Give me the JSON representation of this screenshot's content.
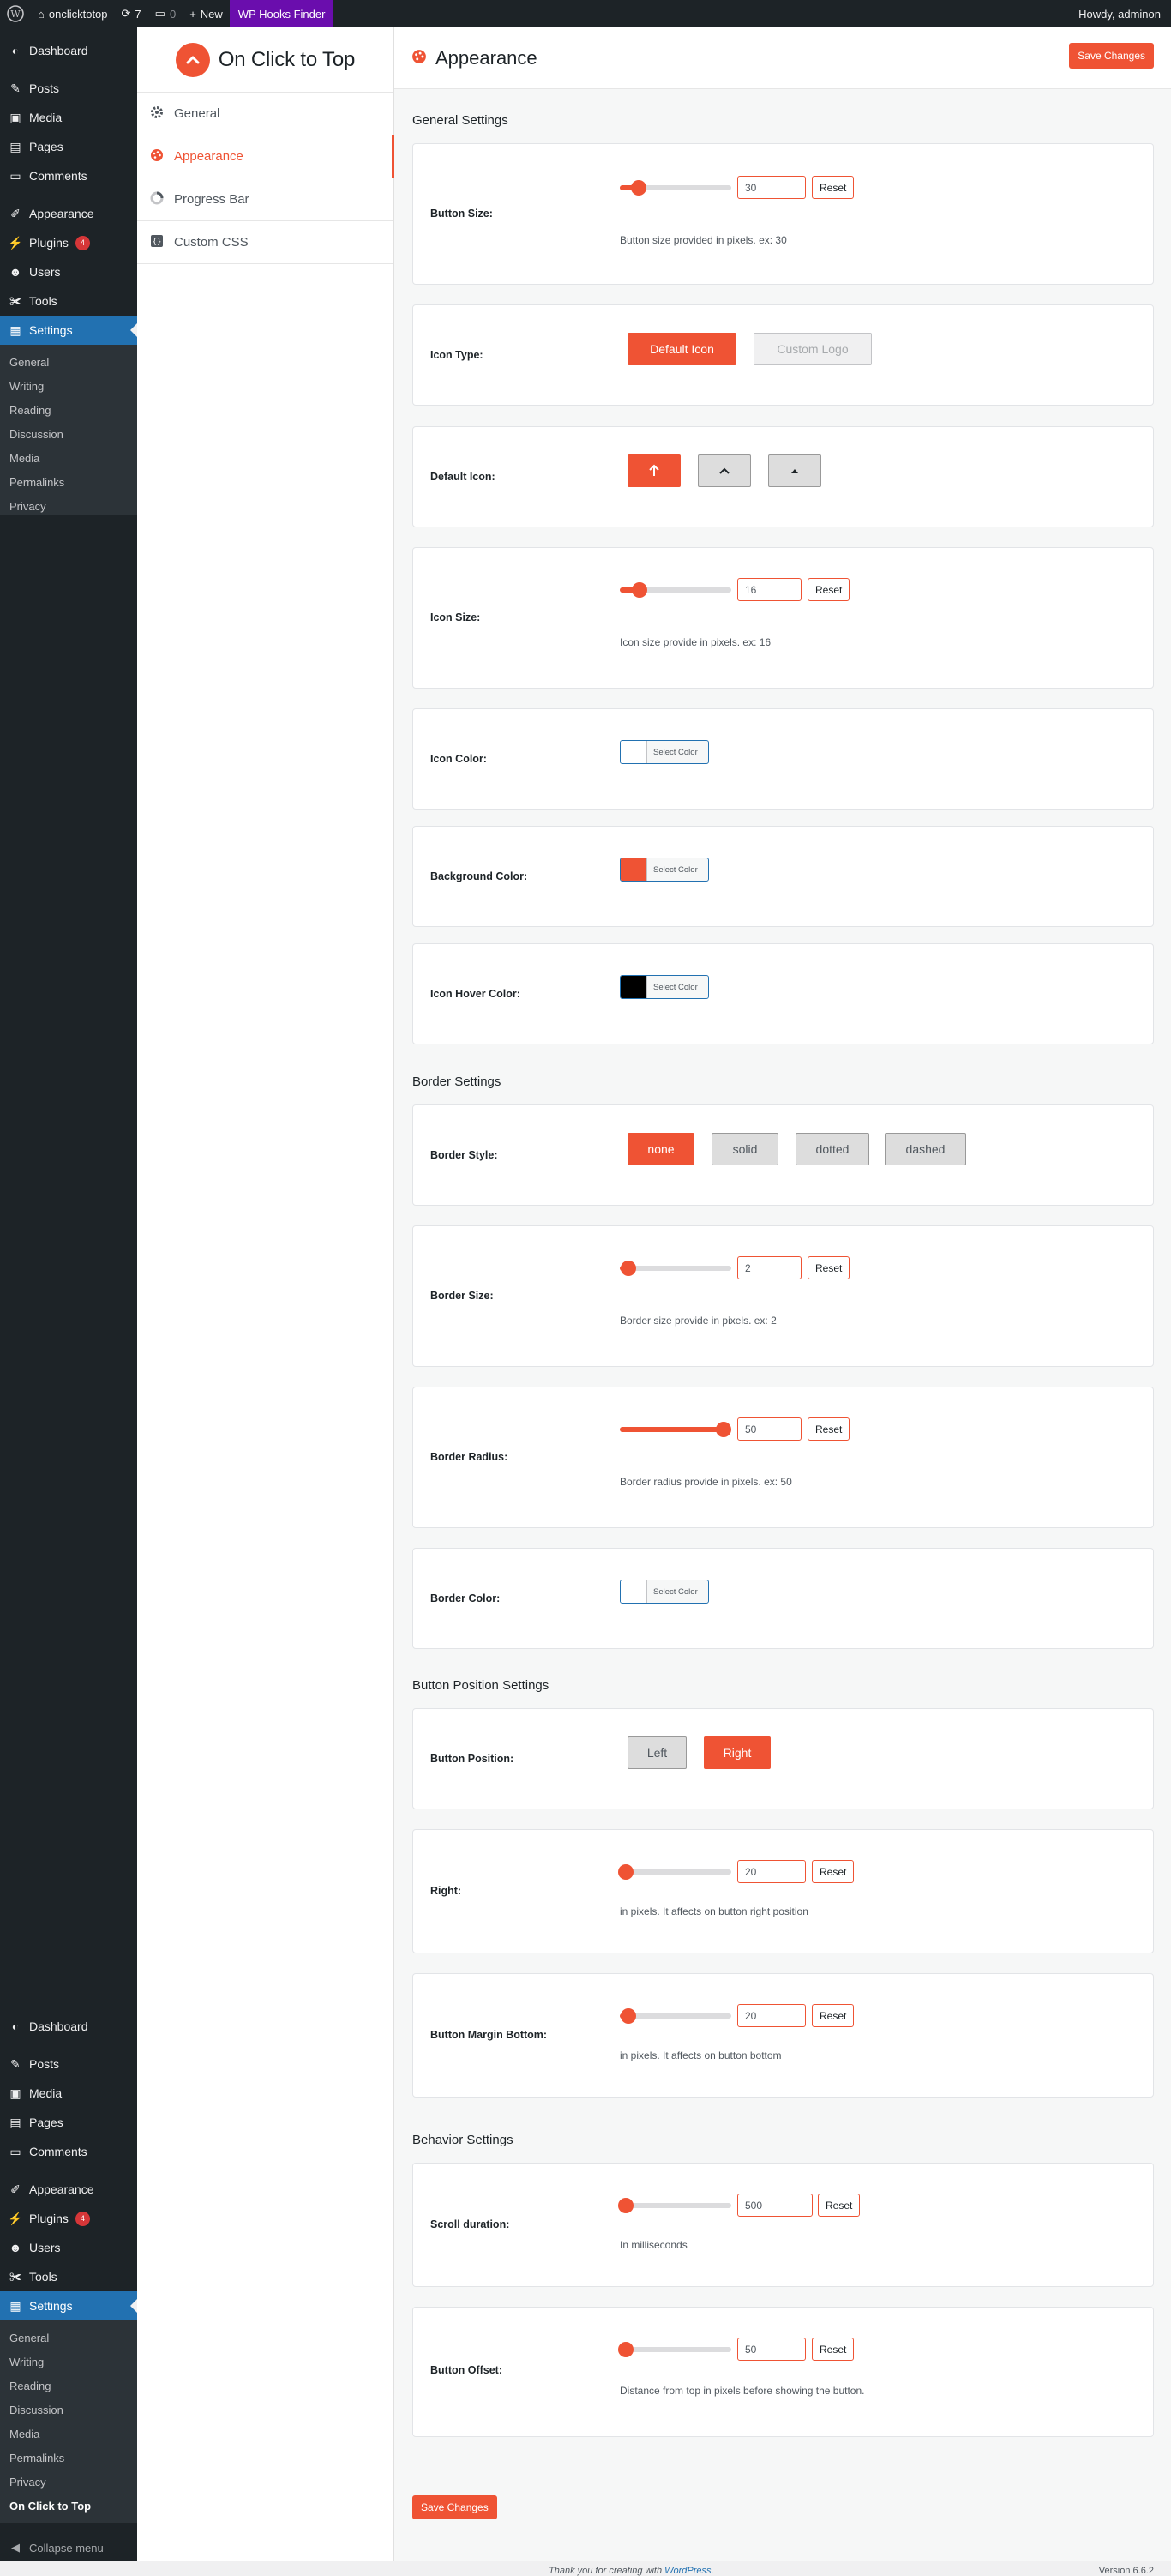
{
  "adminbar": {
    "site": "onclicktotop",
    "updates": "7",
    "comments": "0",
    "new": "New",
    "hooks": "WP Hooks Finder",
    "howdy": "Howdy, adminon"
  },
  "wp_menu": {
    "items": [
      "Dashboard",
      "Posts",
      "Media",
      "Pages",
      "Comments",
      "Appearance",
      "Plugins",
      "Users",
      "Tools",
      "Settings"
    ],
    "plugins_badge": "4",
    "settings_sub_top": [
      "General",
      "Writing",
      "Reading",
      "Discussion",
      "Media",
      "Permalinks",
      "Privacy"
    ],
    "settings_sub_bottom": [
      "General",
      "Writing",
      "Reading",
      "Discussion",
      "Media",
      "Permalinks",
      "Privacy",
      "On Click to Top"
    ],
    "collapse": "Collapse menu"
  },
  "plugin_nav": {
    "brand": "On Click to Top",
    "items": [
      "General",
      "Appearance",
      "Progress Bar",
      "Custom CSS"
    ]
  },
  "page": {
    "title": "Appearance",
    "save": "Save Changes"
  },
  "sections": {
    "general": "General Settings",
    "border": "Border Settings",
    "position": "Button Position Settings",
    "behavior": "Behavior Settings"
  },
  "fields": {
    "button_size": {
      "label": "Button Size:",
      "value": "30",
      "fraction": 0.17,
      "reset": "Reset",
      "hint": "Button size provided in pixels. ex: 30"
    },
    "icon_type": {
      "label": "Icon Type:",
      "options": [
        "Default Icon",
        "Custom Logo"
      ],
      "selected": "Default Icon"
    },
    "default_icon": {
      "label": "Default Icon:"
    },
    "icon_size": {
      "label": "Icon Size:",
      "value": "16",
      "fraction": 0.18,
      "reset": "Reset",
      "hint": "Icon size provide in pixels. ex: 16"
    },
    "icon_color": {
      "label": "Icon Color:",
      "swatch": "#ffffff",
      "btn": "Select Color"
    },
    "bg_color": {
      "label": "Background Color:",
      "swatch": "#ef5334",
      "btn": "Select Color"
    },
    "hover_color": {
      "label": "Icon Hover Color:",
      "swatch": "#000000",
      "btn": "Select Color"
    },
    "border_style": {
      "label": "Border Style:",
      "options": [
        "none",
        "solid",
        "dotted",
        "dashed"
      ],
      "selected": "none"
    },
    "border_size": {
      "label": "Border Size:",
      "value": "2",
      "fraction": 0.08,
      "reset": "Reset",
      "hint": "Border size provide in pixels. ex: 2"
    },
    "border_radius": {
      "label": "Border Radius:",
      "value": "50",
      "fraction": 0.93,
      "reset": "Reset",
      "hint": "Border radius provide in pixels. ex: 50"
    },
    "border_color": {
      "label": "Border Color:",
      "swatch": "#ffffff",
      "btn": "Select Color"
    },
    "button_position": {
      "label": "Button Position:",
      "options": [
        "Left",
        "Right"
      ],
      "selected": "Right"
    },
    "right": {
      "label": "Right:",
      "value": "20",
      "fraction": 0.05,
      "reset": "Reset",
      "hint": "in pixels. It affects on button right position"
    },
    "margin_bottom": {
      "label": "Button Margin Bottom:",
      "value": "20",
      "fraction": 0.08,
      "reset": "Reset",
      "hint": "in pixels. It affects on button bottom"
    },
    "scroll_duration": {
      "label": "Scroll duration:",
      "value": "500",
      "fraction": 0.05,
      "reset": "Reset",
      "hint": "In milliseconds"
    },
    "button_offset": {
      "label": "Button Offset:",
      "value": "50",
      "fraction": 0.05,
      "reset": "Reset",
      "hint": "Distance from top in pixels before showing the button."
    }
  },
  "footer": {
    "thanks": "Thank you for creating with",
    "link": "WordPress",
    "version": "Version 6.6.2"
  },
  "colors": {
    "accent": "#ef5334",
    "admin_dark": "#1d2327",
    "admin_blue": "#2271b1"
  }
}
